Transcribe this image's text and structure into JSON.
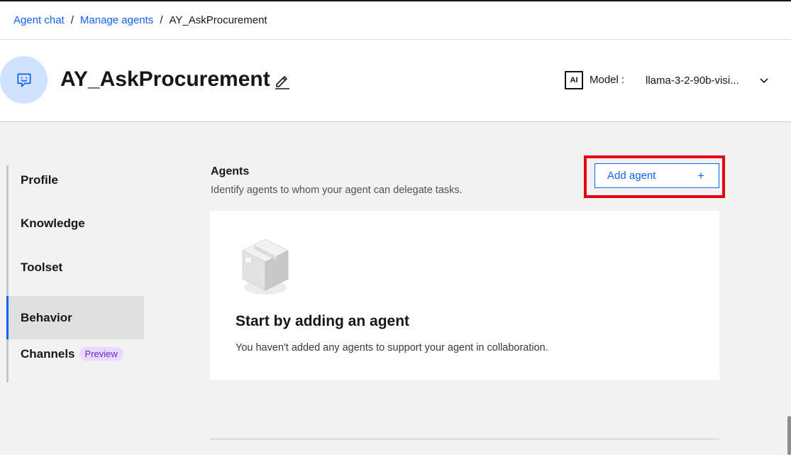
{
  "breadcrumb": {
    "items": [
      "Agent chat",
      "Manage agents"
    ],
    "separator": "/",
    "current": "AY_AskProcurement"
  },
  "header": {
    "agent_name": "AY_AskProcurement",
    "ai_badge": "AI",
    "model_label": "Model :",
    "model_value": "llama-3-2-90b-visi..."
  },
  "sidebar": {
    "items": [
      {
        "label": "Profile"
      },
      {
        "label": "Knowledge"
      },
      {
        "label": "Toolset"
      },
      {
        "label": "Behavior",
        "active": true
      },
      {
        "label": "Channels",
        "badge": "Preview"
      }
    ]
  },
  "main": {
    "title": "Agents",
    "subtitle": "Identify agents to whom your agent can delegate tasks.",
    "add_button_label": "Add agent",
    "add_button_icon": "+",
    "empty_state": {
      "title": "Start by adding an agent",
      "description": "You haven't added any agents to support your agent in collaboration."
    }
  },
  "colors": {
    "accent": "#0f62fe",
    "highlight": "#e8000b",
    "avatar_bg": "#d0e2ff",
    "preview_badge_bg": "#e8daff"
  }
}
